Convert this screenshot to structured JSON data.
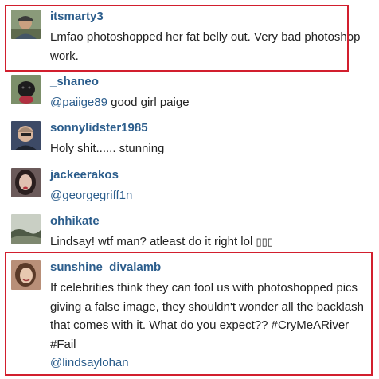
{
  "comments": [
    {
      "username": "itsmarty3",
      "text": "Lmfao photoshopped her fat belly out. Very bad photoshop work.",
      "avatar": "man-with-cap-avatar"
    },
    {
      "username": "_shaneo",
      "mention": "@paiige89",
      "text": "good girl paige",
      "avatar": "black-dog-avatar"
    },
    {
      "username": "sonnylidster1985",
      "text": "Holy shit...... stunning",
      "avatar": "shaved-head-man-avatar"
    },
    {
      "username": "jackeerakos",
      "mention": "@georgegriff1n",
      "avatar": "dark-hair-woman-avatar"
    },
    {
      "username": "ohhikate",
      "text": "Lindsay! wtf man? atleast do it right lol",
      "emoji_placeholders": "▯▯▯",
      "avatar": "landscape-avatar"
    },
    {
      "username": "sunshine_divalamb",
      "text": "If celebrities think they can fool us with photoshopped pics giving a false image, they shouldn't wonder all the backlash that comes with it. What do you expect?? #CryMeARiver #Fail",
      "mention": "@lindsaylohan",
      "avatar": "smiling-woman-avatar"
    }
  ],
  "highlight_color": "#d21f2e",
  "username_color": "#2b5d8c"
}
